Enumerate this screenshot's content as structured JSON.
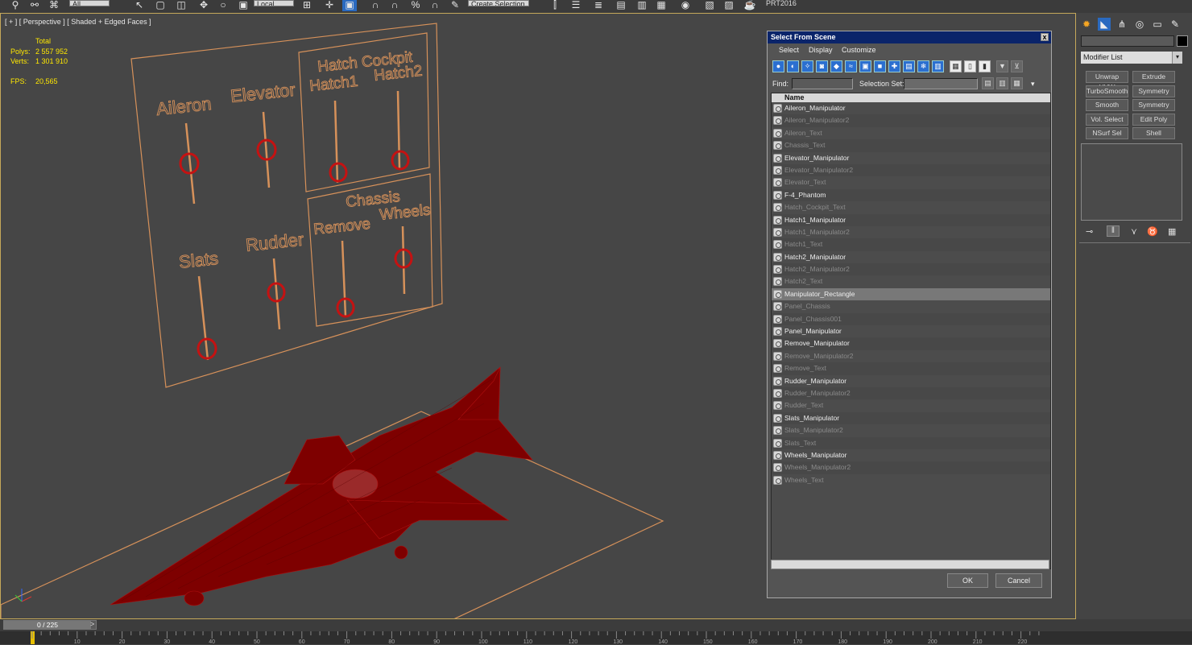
{
  "toolbar": {
    "coordinate_dropdown": "Local",
    "filter_dropdown": "All",
    "selection_set_dropdown": "Create Selection Se",
    "prt_label": "PRT2016"
  },
  "viewport": {
    "label": "[ + ] [ Perspective ] [ Shaded + Edged Faces ]",
    "stats": {
      "total_label": "Total",
      "polys_label": "Polys:",
      "polys_value": "2 557 952",
      "verts_label": "Verts:",
      "verts_value": "1 301 910",
      "fps_label": "FPS:",
      "fps_value": "20,565"
    },
    "panel_labels": {
      "aileron": "Aileron",
      "elevator": "Elevator",
      "hatch_cockpit": "Hatch Cockpit",
      "hatch1": "Hatch1",
      "hatch2": "Hatch2",
      "slats": "Slats",
      "rudder": "Rudder",
      "chassis": "Chassis",
      "remove": "Remove",
      "wheels": "Wheels"
    },
    "colors": {
      "wire_orange": "#d6915a",
      "manipulator_red": "#c41212",
      "plane_red": "#8a0000"
    }
  },
  "dialog": {
    "title": "Select From Scene",
    "close": "x",
    "menu": [
      "Select",
      "Display",
      "Customize"
    ],
    "find_label": "Find:",
    "selection_set_label": "Selection Set:",
    "column_name": "Name",
    "ok_label": "OK",
    "cancel_label": "Cancel",
    "items": [
      {
        "name": "Aileron_Manipulator",
        "state": "bright"
      },
      {
        "name": "Aileron_Manipulator2",
        "state": "dim"
      },
      {
        "name": "Aileron_Text",
        "state": "dim"
      },
      {
        "name": "Chassis_Text",
        "state": "dim"
      },
      {
        "name": "Elevator_Manipulator",
        "state": "bright"
      },
      {
        "name": "Elevator_Manipulator2",
        "state": "dim"
      },
      {
        "name": "Elevator_Text",
        "state": "dim"
      },
      {
        "name": "F-4_Phantom",
        "state": "bright"
      },
      {
        "name": "Hatch_Cockpit_Text",
        "state": "dim"
      },
      {
        "name": "Hatch1_Manipulator",
        "state": "bright"
      },
      {
        "name": "Hatch1_Manipulator2",
        "state": "dim"
      },
      {
        "name": "Hatch1_Text",
        "state": "dim"
      },
      {
        "name": "Hatch2_Manipulator",
        "state": "bright"
      },
      {
        "name": "Hatch2_Manipulator2",
        "state": "dim"
      },
      {
        "name": "Hatch2_Text",
        "state": "dim"
      },
      {
        "name": "Manipulator_Rectangle",
        "state": "selected"
      },
      {
        "name": "Panel_Chassis",
        "state": "dim"
      },
      {
        "name": "Panel_Chassis001",
        "state": "dim"
      },
      {
        "name": "Panel_Manipulator",
        "state": "bright"
      },
      {
        "name": "Remove_Manipulator",
        "state": "bright"
      },
      {
        "name": "Remove_Manipulator2",
        "state": "dim"
      },
      {
        "name": "Remove_Text",
        "state": "dim"
      },
      {
        "name": "Rudder_Manipulator",
        "state": "bright"
      },
      {
        "name": "Rudder_Manipulator2",
        "state": "dim"
      },
      {
        "name": "Rudder_Text",
        "state": "dim"
      },
      {
        "name": "Slats_Manipulator",
        "state": "bright"
      },
      {
        "name": "Slats_Manipulator2",
        "state": "dim"
      },
      {
        "name": "Slats_Text",
        "state": "dim"
      },
      {
        "name": "Wheels_Manipulator",
        "state": "bright"
      },
      {
        "name": "Wheels_Manipulator2",
        "state": "dim"
      },
      {
        "name": "Wheels_Text",
        "state": "dim"
      }
    ]
  },
  "command_panel": {
    "modifier_list": "Modifier List",
    "modifier_buttons": [
      "Unwrap UVW",
      "Extrude",
      "TurboSmooth",
      "Symmetry",
      "Smooth",
      "Symmetry",
      "Vol. Select",
      "Edit Poly",
      "NSurf Sel",
      "Shell"
    ]
  },
  "timeline": {
    "frame_display": "0 / 225",
    "ticks": [
      "10",
      "20",
      "30",
      "40",
      "50",
      "60",
      "70",
      "80",
      "90",
      "100",
      "110",
      "120",
      "130",
      "140",
      "150",
      "160",
      "170",
      "180",
      "190",
      "200",
      "210",
      "220"
    ]
  }
}
